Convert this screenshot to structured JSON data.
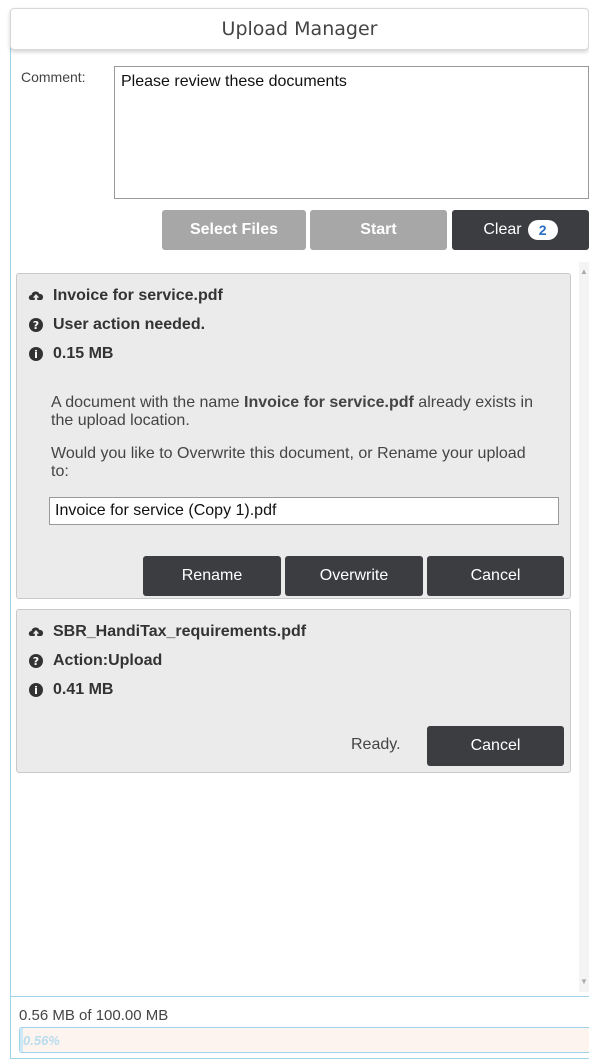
{
  "window": {
    "title": "Upload Manager"
  },
  "comment": {
    "label": "Comment:",
    "value": "Please review these documents"
  },
  "toolbar": {
    "select_files_label": "Select Files",
    "start_label": "Start",
    "clear_label": "Clear",
    "clear_count": "2"
  },
  "files": [
    {
      "name": "Invoice for service.pdf",
      "status": "User action needed.",
      "size": "0.15 MB",
      "conflict_prefix": "A document with the name ",
      "conflict_name": "Invoice for service.pdf",
      "conflict_suffix": " already exists in the upload location.",
      "question": "Would you like to Overwrite this document, or Rename your upload to:",
      "rename_value": "Invoice for service (Copy 1).pdf",
      "rename_label": "Rename",
      "overwrite_label": "Overwrite",
      "cancel_label": "Cancel"
    },
    {
      "name": "SBR_HandiTax_requirements.pdf",
      "status": "Action:Upload",
      "size": "0.41 MB",
      "ready_text": "Ready.",
      "cancel_label": "Cancel"
    }
  ],
  "footer": {
    "usage": "0.56 MB of 100.00 MB",
    "progress_label": "0.56%",
    "progress_percent": 0.56
  },
  "icons": {
    "upload": "cloud-upload-icon",
    "question": "question-circle-icon",
    "info": "info-circle-icon"
  },
  "colors": {
    "dark_button": "#3b3d40",
    "gray_button": "#a7a7a7",
    "badge_text": "#2a6ec0",
    "accent_border": "#9fd3ea",
    "card_bg": "#ebebeb"
  }
}
